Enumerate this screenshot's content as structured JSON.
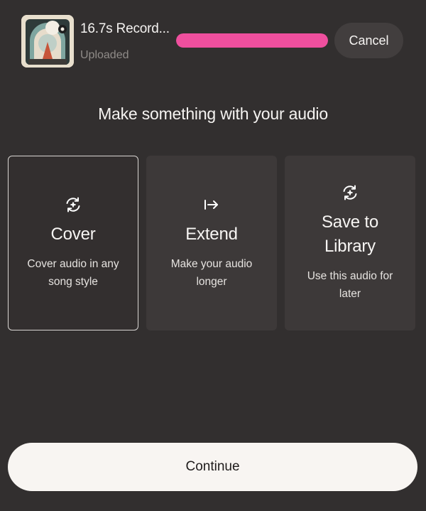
{
  "upload": {
    "file_name": "16.7s Record...",
    "status": "Uploaded",
    "progress": 1.0,
    "progress_color": "#ef4f9e",
    "cancel_label": "Cancel"
  },
  "heading": "Make something with your audio",
  "options": [
    {
      "icon": "refresh-sparkle-icon",
      "title": "Cover",
      "description": "Cover audio in any song style",
      "selected": true
    },
    {
      "icon": "arrow-right-bar-icon",
      "title": "Extend",
      "description": "Make your audio longer",
      "selected": false
    },
    {
      "icon": "refresh-sparkle-icon",
      "title": "Save to Library",
      "description": "Use this audio for later",
      "selected": false
    }
  ],
  "continue_label": "Continue"
}
